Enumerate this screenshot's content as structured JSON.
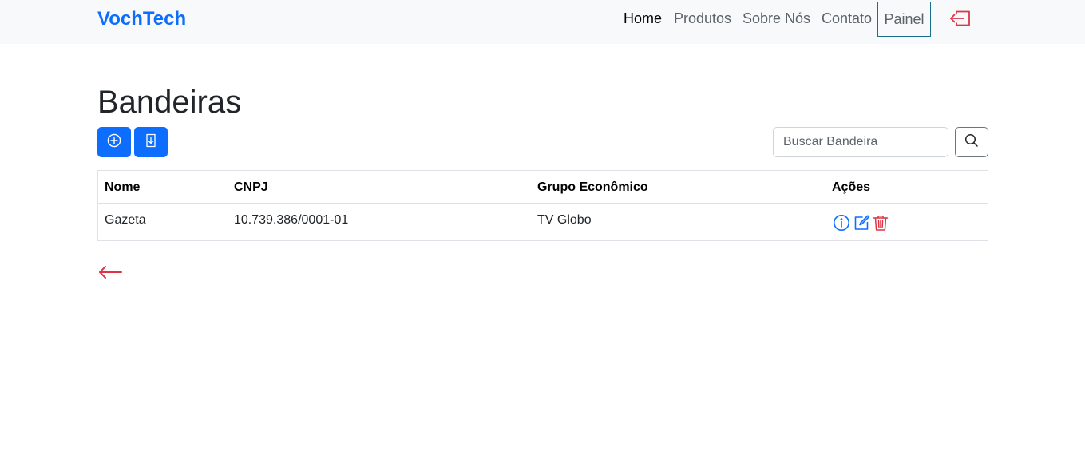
{
  "navbar": {
    "brand": "VochTech",
    "links": [
      "Home",
      "Produtos",
      "Sobre Nós",
      "Contato"
    ],
    "painel": "Painel",
    "logout_icon": "box-arrow-left-icon"
  },
  "page": {
    "title": "Bandeiras",
    "add_icon": "plus-circle-icon",
    "export_icon": "file-arrow-down-icon",
    "search": {
      "placeholder": "Buscar Bandeira",
      "value": ""
    },
    "search_icon": "search-icon"
  },
  "table": {
    "columns": [
      "Nome",
      "CNPJ",
      "Grupo Econômico",
      "Ações"
    ],
    "rows": [
      {
        "nome": "Gazeta",
        "cnpj": "10.739.386/0001-01",
        "grupo": "TV Globo"
      }
    ],
    "action_icons": [
      "info-circle-icon",
      "pencil-square-icon",
      "trash-icon"
    ]
  },
  "back_icon": "arrow-left-icon",
  "colors": {
    "primary": "#0d6efd",
    "danger": "#dc3545",
    "navbar_bg": "#f8f9fa",
    "painel_border": "#1a6f8a"
  }
}
